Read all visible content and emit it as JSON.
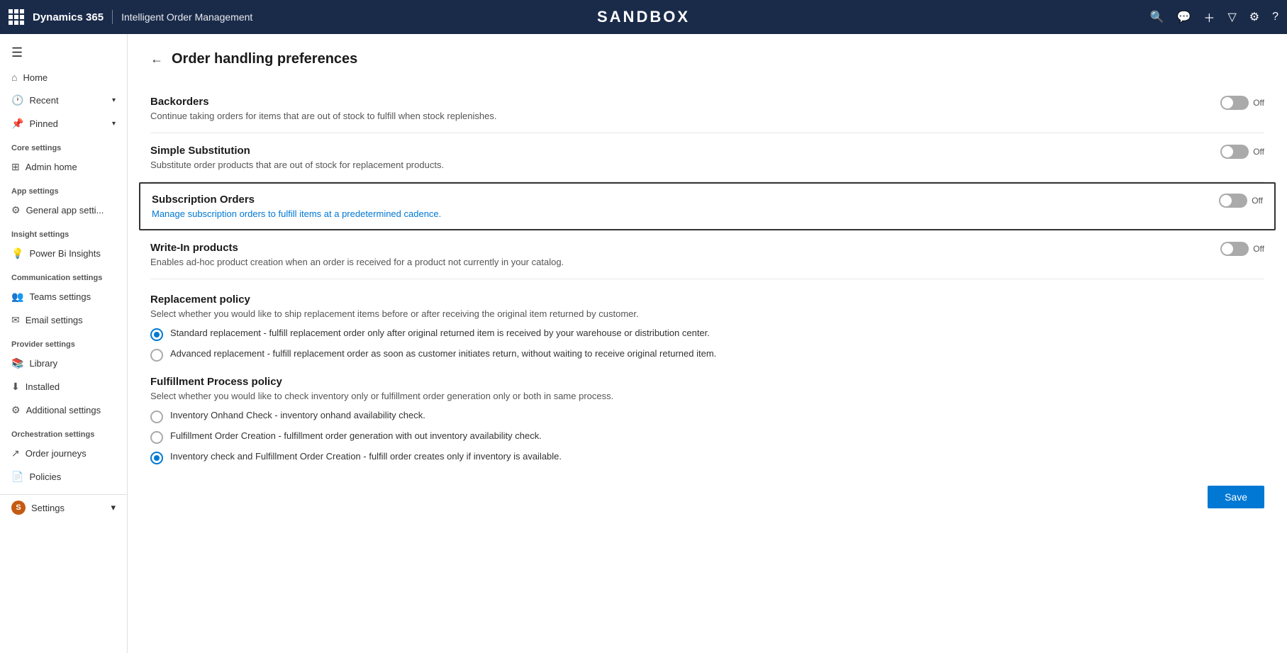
{
  "topnav": {
    "brand": "Dynamics 365",
    "module": "Intelligent Order Management",
    "sandbox_label": "SANDBOX"
  },
  "sidebar": {
    "hamburger_icon": "☰",
    "nav_items": [
      {
        "id": "home",
        "label": "Home",
        "icon": "⌂"
      },
      {
        "id": "recent",
        "label": "Recent",
        "icon": "🕐",
        "has_chevron": true
      },
      {
        "id": "pinned",
        "label": "Pinned",
        "icon": "📌",
        "has_chevron": true
      }
    ],
    "sections": [
      {
        "header": "Core settings",
        "items": [
          {
            "id": "admin-home",
            "label": "Admin home",
            "icon": "⊞"
          }
        ]
      },
      {
        "header": "App settings",
        "items": [
          {
            "id": "general-app",
            "label": "General app setti...",
            "icon": "⚙"
          }
        ]
      },
      {
        "header": "Insight settings",
        "items": [
          {
            "id": "power-bi",
            "label": "Power Bi Insights",
            "icon": "💡"
          }
        ]
      },
      {
        "header": "Communication settings",
        "items": [
          {
            "id": "teams",
            "label": "Teams settings",
            "icon": "👥"
          },
          {
            "id": "email",
            "label": "Email settings",
            "icon": "✉"
          }
        ]
      },
      {
        "header": "Provider settings",
        "items": [
          {
            "id": "library",
            "label": "Library",
            "icon": "📚"
          },
          {
            "id": "installed",
            "label": "Installed",
            "icon": "⬇"
          },
          {
            "id": "additional",
            "label": "Additional settings",
            "icon": "⚙"
          }
        ]
      },
      {
        "header": "Orchestration settings",
        "items": [
          {
            "id": "order-journeys",
            "label": "Order journeys",
            "icon": "↗"
          },
          {
            "id": "policies",
            "label": "Policies",
            "icon": "📄"
          }
        ]
      }
    ],
    "bottom": {
      "label": "Settings",
      "badge": "S"
    }
  },
  "page": {
    "title": "Order handling preferences",
    "back_label": "←"
  },
  "settings": {
    "backorders": {
      "name": "Backorders",
      "desc": "Continue taking orders for items that are out of stock to fulfill when stock replenishes.",
      "toggle_label": "Off",
      "state": "off"
    },
    "simple_substitution": {
      "name": "Simple Substitution",
      "desc": "Substitute order products that are out of stock for replacement products.",
      "toggle_label": "Off",
      "state": "off"
    },
    "subscription_orders": {
      "name": "Subscription Orders",
      "desc": "Manage subscription orders to fulfill items at a predetermined cadence.",
      "toggle_label": "Off",
      "state": "off",
      "highlighted": true
    },
    "write_in_products": {
      "name": "Write-In products",
      "desc": "Enables ad-hoc product creation when an order is received for a product not currently in your catalog.",
      "toggle_label": "Off",
      "state": "off"
    }
  },
  "replacement_policy": {
    "title": "Replacement policy",
    "desc": "Select whether you would like to ship replacement items before or after receiving the original item returned by customer.",
    "options": [
      {
        "id": "standard",
        "label": "Standard replacement - fulfill replacement order only after original returned item is received by your warehouse or distribution center.",
        "selected": true
      },
      {
        "id": "advanced",
        "label": "Advanced replacement - fulfill replacement order as soon as customer initiates return, without waiting to receive original returned item.",
        "selected": false
      }
    ]
  },
  "fulfillment_policy": {
    "title": "Fulfillment Process policy",
    "desc": "Select whether you would like to check inventory only or fulfillment order generation only or both in same process.",
    "options": [
      {
        "id": "inventory-check",
        "label": "Inventory Onhand Check - inventory onhand availability check.",
        "selected": false
      },
      {
        "id": "fulfillment-order",
        "label": "Fulfillment Order Creation - fulfillment order generation with out inventory availability check.",
        "selected": false
      },
      {
        "id": "both",
        "label": "Inventory check and Fulfillment Order Creation - fulfill order creates only if inventory is available.",
        "selected": true
      }
    ]
  },
  "save_button": {
    "label": "Save"
  }
}
